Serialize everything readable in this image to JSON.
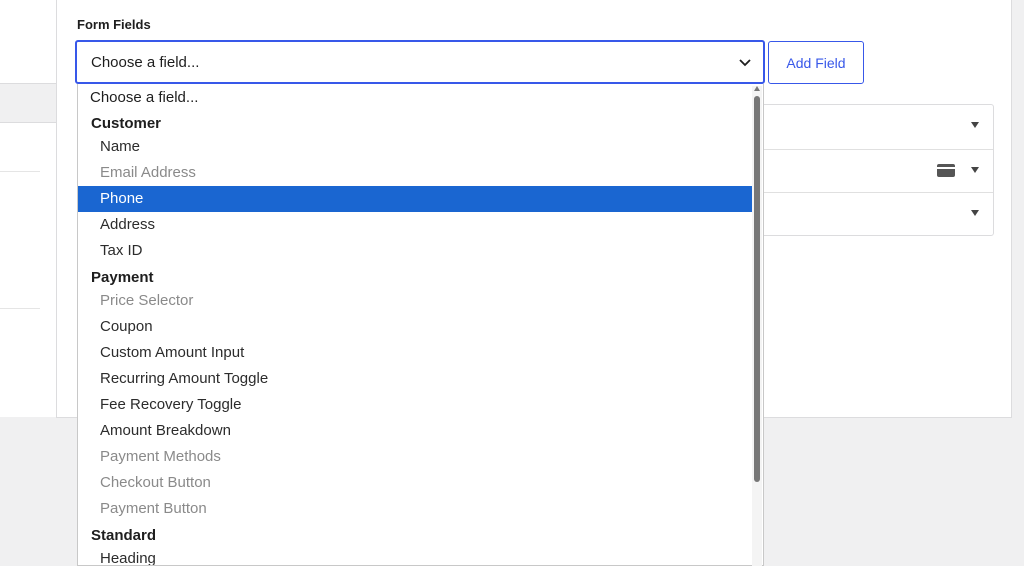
{
  "form_fields": {
    "section_label": "Form Fields",
    "select_value": "Choose a field...",
    "add_button_label": "Add Field"
  },
  "dropdown": {
    "placeholder": "Choose a field...",
    "groups": [
      {
        "label": "Customer",
        "options": [
          {
            "label": "Name",
            "disabled": false,
            "selected": false
          },
          {
            "label": "Email Address",
            "disabled": true,
            "selected": false
          },
          {
            "label": "Phone",
            "disabled": false,
            "selected": true
          },
          {
            "label": "Address",
            "disabled": false,
            "selected": false
          },
          {
            "label": "Tax ID",
            "disabled": false,
            "selected": false
          }
        ]
      },
      {
        "label": "Payment",
        "options": [
          {
            "label": "Price Selector",
            "disabled": true,
            "selected": false
          },
          {
            "label": "Coupon",
            "disabled": false,
            "selected": false
          },
          {
            "label": "Custom Amount Input",
            "disabled": false,
            "selected": false
          },
          {
            "label": "Recurring Amount Toggle",
            "disabled": false,
            "selected": false
          },
          {
            "label": "Fee Recovery Toggle",
            "disabled": false,
            "selected": false
          },
          {
            "label": "Amount Breakdown",
            "disabled": false,
            "selected": false
          },
          {
            "label": "Payment Methods",
            "disabled": true,
            "selected": false
          },
          {
            "label": "Checkout Button",
            "disabled": true,
            "selected": false
          },
          {
            "label": "Payment Button",
            "disabled": true,
            "selected": false
          }
        ]
      },
      {
        "label": "Standard",
        "options": [
          {
            "label": "Heading",
            "disabled": false,
            "selected": false
          }
        ]
      }
    ]
  },
  "icons": {
    "select_chevron": "chevron-down-icon",
    "row_caret": "caret-down-icon",
    "card": "credit-card-icon"
  },
  "colors": {
    "accent": "#3858e9",
    "selected_option_bg": "#1a66d1",
    "disabled_text": "#8a8a8a"
  }
}
